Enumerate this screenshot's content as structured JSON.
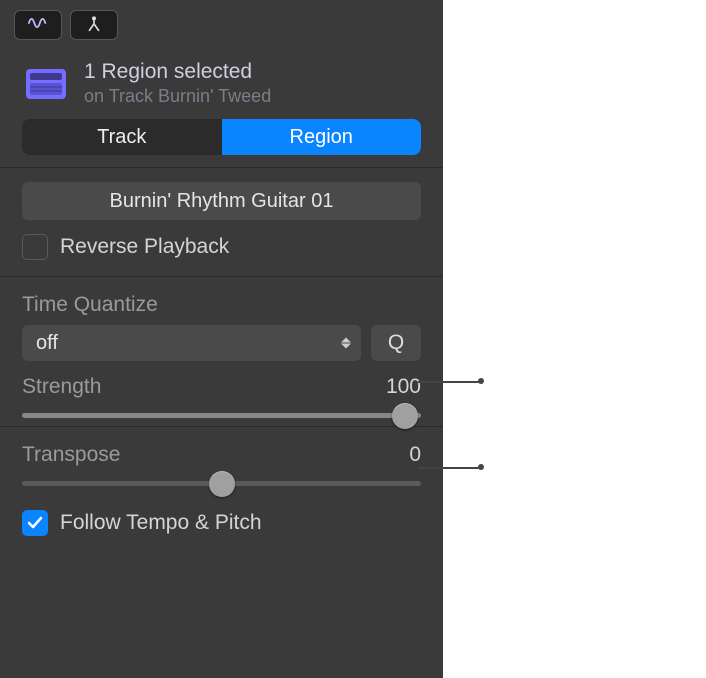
{
  "header": {
    "title": "1 Region selected",
    "subtitle": "on Track Burnin' Tweed"
  },
  "segmented": {
    "items": [
      "Track",
      "Region"
    ],
    "active_index": 1
  },
  "region_name": "Burnin' Rhythm Guitar 01",
  "reverse_playback": {
    "label": "Reverse Playback",
    "checked": false
  },
  "time_quantize": {
    "label": "Time Quantize",
    "value": "off",
    "q_button_label": "Q"
  },
  "strength": {
    "label": "Strength",
    "value": 100,
    "min": 0,
    "max": 100
  },
  "transpose": {
    "label": "Transpose",
    "value": 0,
    "min": -100,
    "max": 100,
    "slider_percent": 50
  },
  "follow_tempo_pitch": {
    "label": "Follow Tempo & Pitch",
    "checked": true
  },
  "colors": {
    "accent": "#0a84ff"
  }
}
